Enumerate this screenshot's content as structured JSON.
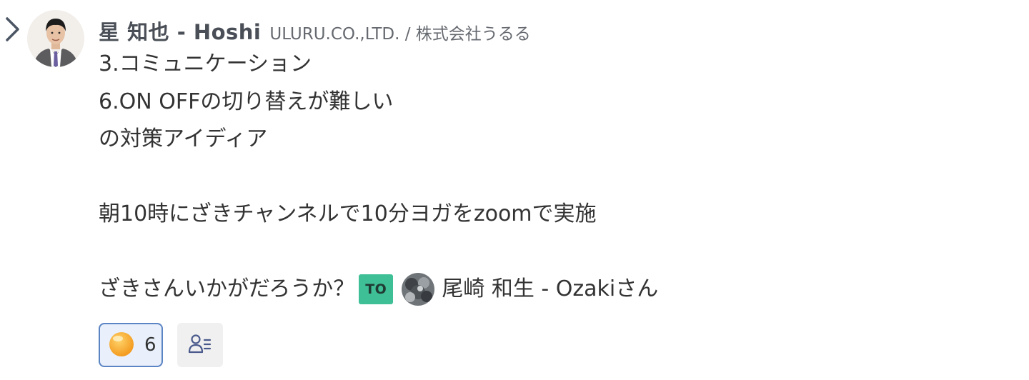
{
  "message": {
    "sender_name": "星 知也 - Hoshi",
    "sender_org": "ULURU.CO.,LTD. / 株式会社うるる",
    "body_lines": [
      "3.コミュニケーション",
      "6.ON OFFの切り替えが難しい",
      "の対策アイディア",
      "",
      "朝10時にざきチャンネルで10分ヨガをzoomで実施",
      ""
    ],
    "mention_prefix": "ざきさんいかがだろうか？",
    "to_badge": "TO",
    "mention_name": "尾崎 和生 - Ozakiさん"
  },
  "reactions": [
    {
      "icon": "smile-face-icon",
      "count": "6"
    }
  ],
  "icons": {
    "expand": "chevron-right-icon",
    "reaction_users": "user-list-icon"
  },
  "colors": {
    "to_badge_bg": "#3fbf96",
    "reaction_border": "#5b84c4",
    "reaction_bg": "#e9f0fb"
  }
}
